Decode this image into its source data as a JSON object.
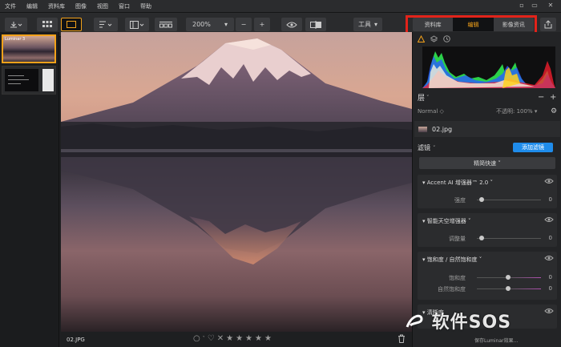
{
  "menu": [
    "文件",
    "编辑",
    "资料库",
    "图像",
    "视图",
    "窗口",
    "帮助"
  ],
  "toolbar": {
    "zoom": "200%",
    "minus": "−",
    "plus": "+",
    "tools_label": "工具",
    "tools_arrow": "▾"
  },
  "modes": {
    "library": "资料库",
    "edit": "编辑",
    "info": "影像资讯",
    "active": "编辑"
  },
  "filmstrip": {
    "thumb1_label": "Luminar 3"
  },
  "status_bar": {
    "filename": "02.JPG",
    "stars": [
      "★",
      "★",
      "★",
      "★",
      "★"
    ]
  },
  "layers": {
    "title": "层",
    "title_arrow": "˅",
    "blend_mode": "Normal ◇",
    "opacity": "不透明: 100% ▾",
    "layer_name": "02.jpg"
  },
  "filters": {
    "title": "滤镜",
    "title_arrow": "˅",
    "add_button": "添加滤镜",
    "essentials": "精简快速 ˅",
    "cards": [
      {
        "title": "▾ Accent AI 增强器™ 2.0 ˅",
        "sliders": [
          {
            "label": "强度",
            "value": "0"
          }
        ]
      },
      {
        "title": "▾ 智能天空增强器 ˅",
        "sliders": [
          {
            "label": "调整量",
            "value": "0"
          }
        ]
      },
      {
        "title": "▾ 饱和度 / 自然饱和度 ˅",
        "sliders": [
          {
            "label": "饱和度",
            "value": "0"
          },
          {
            "label": "自然饱和度",
            "value": "0"
          }
        ]
      },
      {
        "title": "▾ 清晰度",
        "sliders": []
      }
    ]
  },
  "watermark": {
    "text": "软件SOS",
    "sub": "保存Luminar效果..."
  },
  "colors": {
    "accent": "#f2a11a",
    "button_blue": "#1f8ceb",
    "highlight_red": "#e2231a"
  }
}
